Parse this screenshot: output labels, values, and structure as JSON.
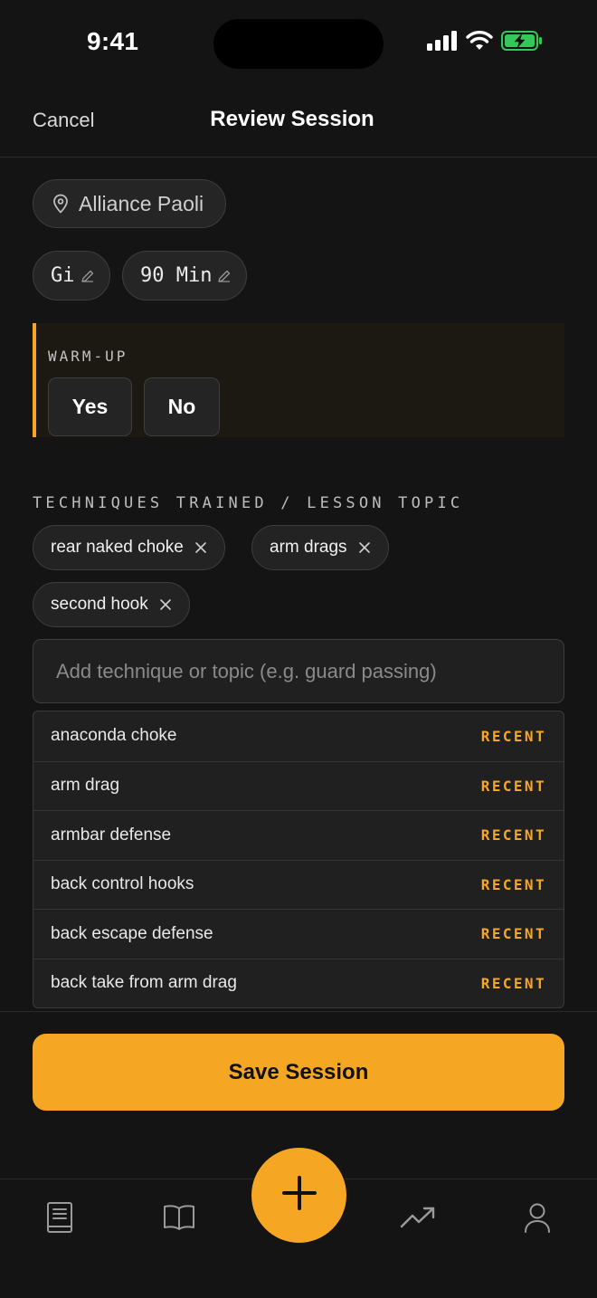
{
  "status_bar": {
    "time": "9:41"
  },
  "header": {
    "cancel_label": "Cancel",
    "title": "Review Session"
  },
  "session": {
    "location": "Alliance Paoli",
    "type": "Gi",
    "duration": "90 Min"
  },
  "warmup": {
    "label": "WARM-UP",
    "yes_label": "Yes",
    "no_label": "No"
  },
  "techniques": {
    "label": "TECHNIQUES TRAINED / LESSON TOPIC",
    "chips": [
      "rear naked choke",
      "arm drags",
      "second hook"
    ],
    "input_placeholder": "Add technique or topic (e.g. guard passing)",
    "suggestions": [
      {
        "name": "anaconda choke",
        "tag": "RECENT"
      },
      {
        "name": "arm drag",
        "tag": "RECENT"
      },
      {
        "name": "armbar defense",
        "tag": "RECENT"
      },
      {
        "name": "back control hooks",
        "tag": "RECENT"
      },
      {
        "name": "back escape defense",
        "tag": "RECENT"
      },
      {
        "name": "back take from arm drag",
        "tag": "RECENT"
      }
    ]
  },
  "save_label": "Save Session",
  "tab_bar": {
    "items": [
      "journal-icon",
      "library-icon",
      "add-icon",
      "progress-icon",
      "profile-icon"
    ]
  },
  "colors": {
    "accent": "#f5a623",
    "background": "#141414",
    "surface": "#232323",
    "battery": "#34c759"
  }
}
